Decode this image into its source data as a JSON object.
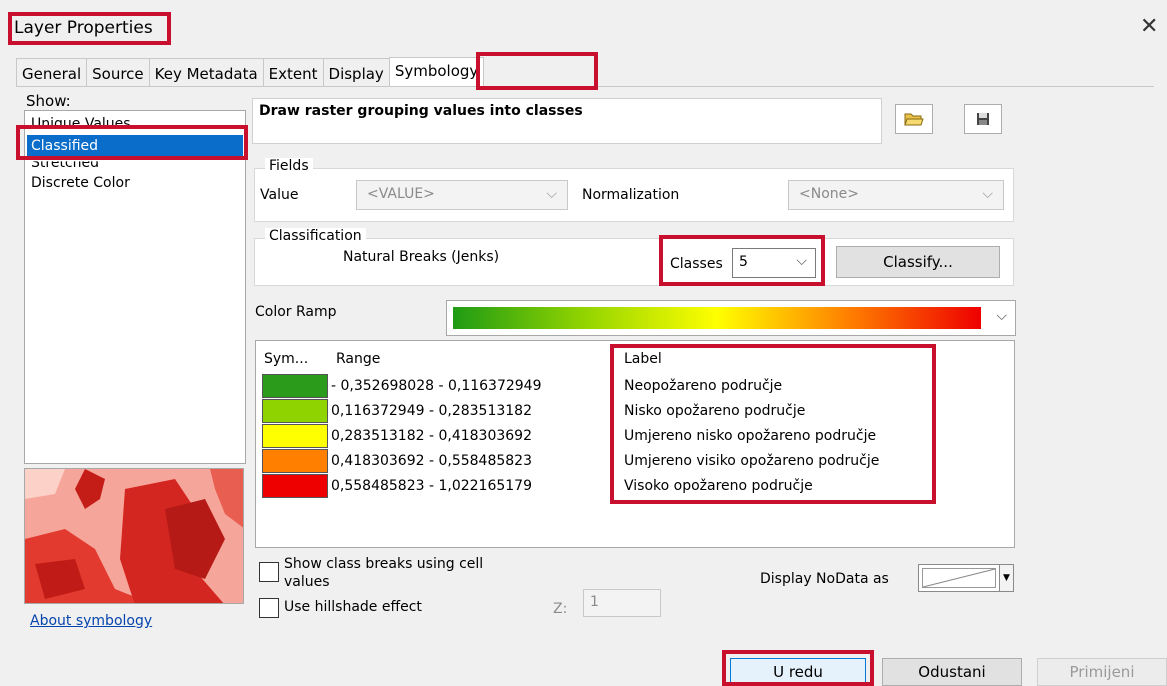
{
  "window": {
    "title": "Layer Properties"
  },
  "tabs": [
    {
      "label": "General"
    },
    {
      "label": "Source"
    },
    {
      "label": "Key Metadata"
    },
    {
      "label": "Extent"
    },
    {
      "label": "Display"
    },
    {
      "label": "Symbology",
      "active": true
    }
  ],
  "show": {
    "label": "Show:",
    "items": [
      {
        "label": "Unique Values"
      },
      {
        "label": "Classified",
        "selected": true
      },
      {
        "label": "Stretched"
      },
      {
        "label": "Discrete Color"
      }
    ]
  },
  "description": "Draw raster grouping values into classes",
  "fields": {
    "legend": "Fields",
    "value_label": "Value",
    "value_selected": "<VALUE>",
    "normalization_label": "Normalization",
    "normalization_selected": "<None>"
  },
  "classification": {
    "legend": "Classification",
    "method": "Natural Breaks (Jenks)",
    "classes_label": "Classes",
    "classes_value": "5",
    "classify_button": "Classify..."
  },
  "color_ramp": {
    "label": "Color Ramp",
    "colors": [
      "#1f9b14",
      "#93d400",
      "#ffff00",
      "#ff7f00",
      "#ee0000"
    ]
  },
  "table": {
    "headers": {
      "symbol": "Sym...",
      "range": "Range",
      "label": "Label"
    },
    "rows": [
      {
        "color": "#2a9b1a",
        "range": "- 0,352698028 - 0,116372949",
        "label": "Neopožareno područje"
      },
      {
        "color": "#8fd400",
        "range": "0,116372949 - 0,283513182",
        "label": "Nisko opožareno područje"
      },
      {
        "color": "#ffff00",
        "range": "0,283513182 - 0,418303692",
        "label": "Umjereno nisko opožareno područje"
      },
      {
        "color": "#ff7f00",
        "range": "0,418303692 - 0,558485823",
        "label": "Umjereno visiko opožareno područje"
      },
      {
        "color": "#ee0000",
        "range": "0,558485823 - 1,022165179",
        "label": "Visoko opožareno područje"
      }
    ]
  },
  "options": {
    "class_breaks_line1": "Show class breaks using cell",
    "class_breaks_line2": "values",
    "hillshade": "Use hillshade effect",
    "z_label": "Z:",
    "z_value": "1",
    "nodata_label": "Display NoData as"
  },
  "about_link": "About symbology",
  "buttons": {
    "ok": "U redu",
    "cancel": "Odustani",
    "apply": "Primijeni"
  },
  "accent": "#c8102e"
}
